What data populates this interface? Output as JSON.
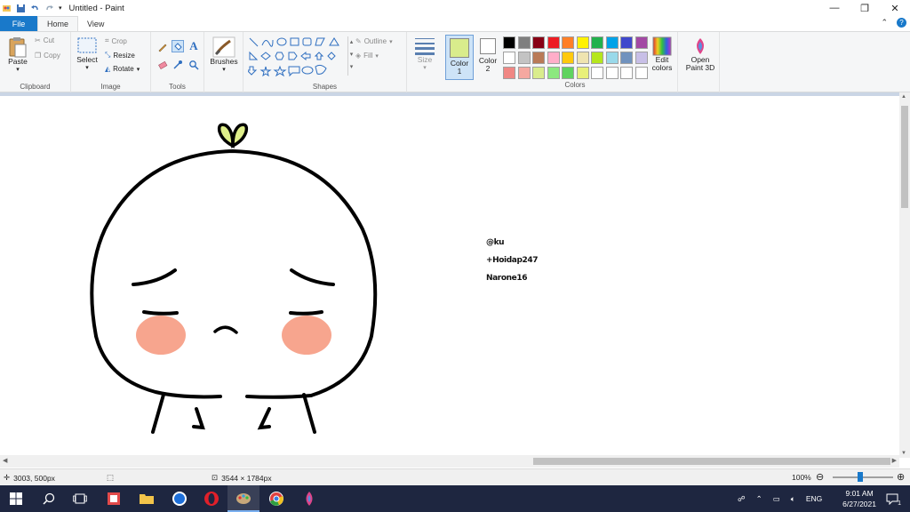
{
  "window": {
    "title": "Untitled - Paint",
    "minimize": "—",
    "restore": "❐",
    "close": "✕"
  },
  "menu": {
    "file": "File",
    "home": "Home",
    "view": "View",
    "help": "?"
  },
  "clipboard": {
    "paste": "Paste",
    "cut": "Cut",
    "copy": "Copy",
    "label": "Clipboard"
  },
  "image": {
    "select": "Select",
    "crop": "Crop",
    "resize": "Resize",
    "rotate": "Rotate",
    "label": "Image"
  },
  "tools": {
    "label": "Tools"
  },
  "brushes": {
    "label": "Brushes"
  },
  "shapes": {
    "outline": "Outline",
    "fill": "Fill",
    "label": "Shapes"
  },
  "size": {
    "label": "Size"
  },
  "color1": {
    "label1": "Color",
    "label2": "1",
    "value": "#d9ec8c"
  },
  "color2": {
    "label1": "Color",
    "label2": "2",
    "value": "#ffffff"
  },
  "colors": {
    "label": "Colors",
    "palette": [
      [
        "#000000",
        "#7f7f7f",
        "#880015",
        "#ed1c24",
        "#ff7f27",
        "#fff200",
        "#22b14c",
        "#00a2e8",
        "#3f48cc",
        "#a349a4"
      ],
      [
        "#ffffff",
        "#c3c3c3",
        "#b97a57",
        "#ffaec9",
        "#ffc90e",
        "#efe4b0",
        "#b5e61d",
        "#99d9ea",
        "#7092be",
        "#c8bfe7"
      ],
      [
        "#f08784",
        "#f5a8a0",
        "#d9ec8c",
        "#8ce87f",
        "#5fd35f",
        "#e8f07a",
        "#ffffff",
        "#ffffff",
        "#ffffff",
        "#ffffff"
      ]
    ],
    "edit_colors_1": "Edit",
    "edit_colors_2": "colors"
  },
  "paint3d": {
    "line1": "Open",
    "line2": "Paint 3D"
  },
  "canvas": {
    "credit_1": "@ku",
    "credit_2": "+Hoidap247",
    "credit_3": "Narone16"
  },
  "status": {
    "cursor_pos": "3003, 500px",
    "image_size": "3544 × 1784px",
    "zoom": "100%"
  },
  "taskbar": {
    "time": "9:01 AM",
    "date": "6/27/2021",
    "lang": "ENG",
    "notif_count": "1"
  }
}
